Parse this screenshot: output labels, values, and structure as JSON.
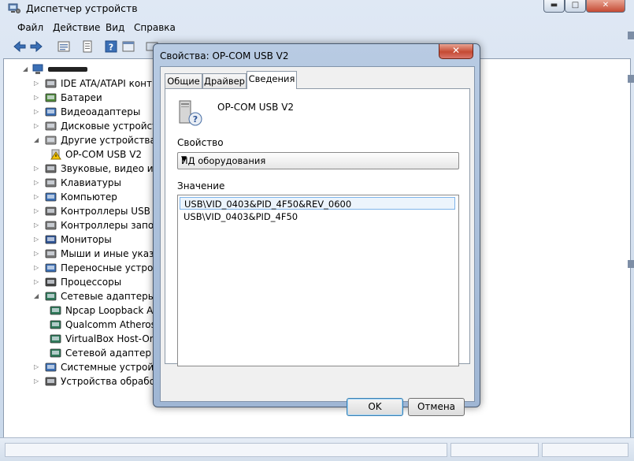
{
  "window": {
    "title": "Диспетчер устройств",
    "buttons": {
      "minimize": "▬",
      "maximize": "□",
      "close": "✕"
    }
  },
  "menu": [
    "Файл",
    "Действие",
    "Вид",
    "Справка"
  ],
  "toolbar": [
    "back-icon",
    "forward-icon",
    "properties-list-icon",
    "document-icon",
    "help-icon",
    "console-icon",
    "update-icon"
  ],
  "tree": {
    "root": "",
    "items": [
      {
        "label": "IDE ATA/ATAPI контроллеры",
        "icon": "ide-icon",
        "expanded": false
      },
      {
        "label": "Батареи",
        "icon": "battery-icon",
        "expanded": false
      },
      {
        "label": "Видеоадаптеры",
        "icon": "display-adapter-icon",
        "expanded": false
      },
      {
        "label": "Дисковые устройства",
        "icon": "disk-icon",
        "expanded": false
      },
      {
        "label": "Другие устройства",
        "icon": "other-devices-icon",
        "expanded": true
      },
      {
        "label": "OP-COM USB V2",
        "icon": "warning-device-icon",
        "child": true
      },
      {
        "label": "Звуковые, видео и игровые устройства",
        "icon": "sound-icon",
        "expanded": false
      },
      {
        "label": "Клавиатуры",
        "icon": "keyboard-icon",
        "expanded": false
      },
      {
        "label": "Компьютер",
        "icon": "computer-icon",
        "expanded": false
      },
      {
        "label": "Контроллеры USB",
        "icon": "usb-icon",
        "expanded": false
      },
      {
        "label": "Контроллеры запоминающих устройств",
        "icon": "storage-controller-icon",
        "expanded": false
      },
      {
        "label": "Мониторы",
        "icon": "monitor-icon",
        "expanded": false
      },
      {
        "label": "Мыши и иные указывающие устройства",
        "icon": "mouse-icon",
        "expanded": false
      },
      {
        "label": "Переносные устройства",
        "icon": "portable-device-icon",
        "expanded": false
      },
      {
        "label": "Процессоры",
        "icon": "processor-icon",
        "expanded": false
      },
      {
        "label": "Сетевые адаптеры",
        "icon": "network-icon",
        "expanded": true
      },
      {
        "label": "Npcap Loopback Adapter",
        "icon": "network-adapter-icon",
        "child": true
      },
      {
        "label": "Qualcomm Atheros",
        "icon": "network-adapter-icon",
        "child": true
      },
      {
        "label": "VirtualBox Host-Only",
        "icon": "network-adapter-icon",
        "child": true
      },
      {
        "label": "Сетевой адаптер Bluetooth",
        "icon": "network-adapter-icon",
        "child": true
      },
      {
        "label": "Системные устройства",
        "icon": "system-devices-icon",
        "expanded": false
      },
      {
        "label": "Устройства обработки изображений",
        "icon": "imaging-icon",
        "expanded": false
      }
    ]
  },
  "dialog": {
    "title": "Свойства: OP-COM USB V2",
    "close_label": "✕",
    "tabs": [
      {
        "label": "Общие",
        "active": false
      },
      {
        "label": "Драйвер",
        "active": false
      },
      {
        "label": "Сведения",
        "active": true
      }
    ],
    "device_name": "OP-COM USB V2",
    "property_label": "Свойство",
    "property_value": "ИД оборудования",
    "value_label": "Значение",
    "values": [
      {
        "text": "USB\\VID_0403&PID_4F50&REV_0600",
        "selected": true
      },
      {
        "text": "USB\\VID_0403&PID_4F50",
        "selected": false
      }
    ],
    "ok_label": "OK",
    "cancel_label": "Отмена"
  },
  "colors": {
    "titlebar": "#c9d8ea",
    "selection_border": "#7eb4ea",
    "close_button": "#c54a33"
  }
}
